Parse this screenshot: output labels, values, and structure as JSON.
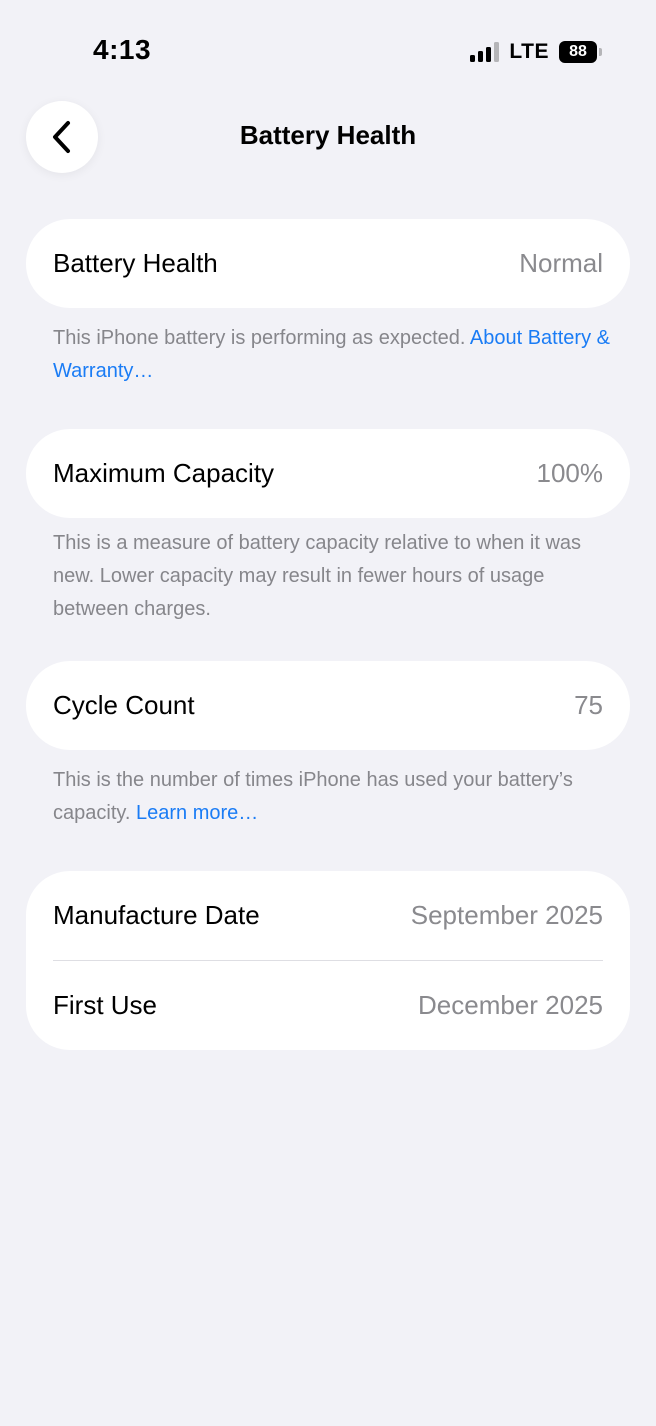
{
  "status_bar": {
    "time": "4:13",
    "network": "LTE",
    "battery_percent": "88"
  },
  "nav": {
    "title": "Battery Health",
    "back_icon": "chevron-left-icon"
  },
  "battery_health": {
    "label": "Battery Health",
    "value": "Normal",
    "footnote_text": "This iPhone battery is performing as expected. ",
    "footnote_link": "About Battery & Warranty…"
  },
  "maximum_capacity": {
    "label": "Maximum Capacity",
    "value": "100%",
    "footnote_text": "This is a measure of battery capacity relative to when it was new. Lower capacity may result in fewer hours of usage between charges."
  },
  "cycle_count": {
    "label": "Cycle Count",
    "value": "75",
    "footnote_text": "This is the number of times iPhone has used your battery’s capacity. ",
    "footnote_link": "Learn more…"
  },
  "dates": {
    "manufacture_label": "Manufacture Date",
    "manufacture_value": "September 2025",
    "first_use_label": "First Use",
    "first_use_value": "December 2025"
  },
  "colors": {
    "background": "#f2f2f7",
    "card": "#ffffff",
    "link": "#1a7cf5",
    "secondary_text": "#8a8a8e"
  }
}
